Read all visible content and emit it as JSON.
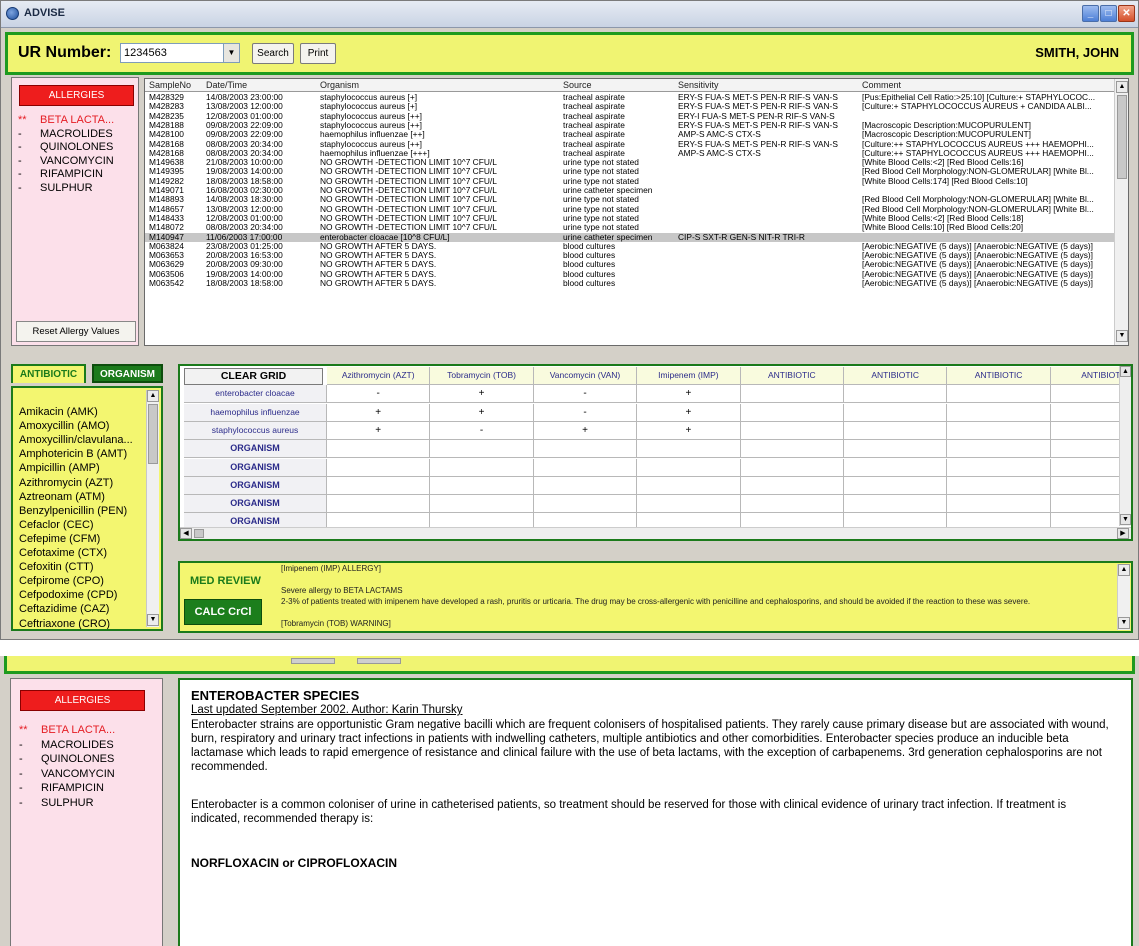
{
  "app": {
    "title": "ADVISE"
  },
  "header": {
    "ur_label": "UR Number:",
    "ur_value": "1234563",
    "search_label": "Search",
    "print_label": "Print",
    "patient_name": "SMITH, JOHN"
  },
  "allergies": {
    "button": "ALLERGIES",
    "reset": "Reset Allergy Values",
    "items": [
      {
        "marker": "**",
        "name": "BETA LACTA...",
        "severe": true
      },
      {
        "marker": "-",
        "name": "MACROLIDES",
        "severe": false
      },
      {
        "marker": "-",
        "name": "QUINOLONES",
        "severe": false
      },
      {
        "marker": "-",
        "name": "VANCOMYCIN",
        "severe": false
      },
      {
        "marker": "-",
        "name": "RIFAMPICIN",
        "severe": false
      },
      {
        "marker": "-",
        "name": "SULPHUR",
        "severe": false
      }
    ]
  },
  "micro": {
    "columns": [
      "SampleNo",
      "Date/Time",
      "Organism",
      "Source",
      "Sensitivity",
      "Comment"
    ],
    "rows": [
      [
        "M428329",
        "14/08/2003 23:00:00",
        "staphylococcus aureus [+]",
        "tracheal aspirate",
        "ERY-S FUA-S MET-S PEN-R RIF-S VAN-S",
        "[Pus:Epithelial Cell Ratio:>25:10] [Culture:+ STAPHYLOCOC..."
      ],
      [
        "M428283",
        "13/08/2003 12:00:00",
        "staphylococcus aureus [+]",
        "tracheal aspirate",
        "ERY-S FUA-S MET-S PEN-R RIF-S VAN-S",
        "[Culture:+ STAPHYLOCOCCUS AUREUS + CANDIDA ALBI..."
      ],
      [
        "M428235",
        "12/08/2003 01:00:00",
        "staphylococcus aureus [++]",
        "tracheal aspirate",
        "ERY-I FUA-S MET-S PEN-R RIF-S VAN-S",
        ""
      ],
      [
        "M428188",
        "09/08/2003 22:09:00",
        "staphylococcus aureus [++]",
        "tracheal aspirate",
        "ERY-S FUA-S MET-S PEN-R RIF-S VAN-S",
        "[Macroscopic Description:MUCOPURULENT]"
      ],
      [
        "M428100",
        "09/08/2003 22:09:00",
        "haemophilus influenzae [++]",
        "tracheal aspirate",
        "AMP-S AMC-S CTX-S",
        "[Macroscopic Description:MUCOPURULENT]"
      ],
      [
        "M428168",
        "08/08/2003 20:34:00",
        "staphylococcus aureus [++]",
        "tracheal aspirate",
        "ERY-S FUA-S MET-S PEN-R RIF-S VAN-S",
        "[Culture:++ STAPHYLOCOCCUS AUREUS +++ HAEMOPHI..."
      ],
      [
        "M428168",
        "08/08/2003 20:34:00",
        "haemophilus influenzae [+++]",
        "tracheal aspirate",
        "AMP-S AMC-S CTX-S",
        "[Culture:++ STAPHYLOCOCCUS AUREUS +++ HAEMOPHI..."
      ],
      [
        "M149638",
        "21/08/2003 10:00:00",
        "NO GROWTH -DETECTION LIMIT 10^7 CFU/L",
        "urine type not stated",
        "",
        "[White Blood Cells:<2] [Red Blood Cells:16]"
      ],
      [
        "M149395",
        "19/08/2003 14:00:00",
        "NO GROWTH -DETECTION LIMIT 10^7 CFU/L",
        "urine type not stated",
        "",
        "[Red Blood Cell Morphology:NON-GLOMERULAR] [White Bl..."
      ],
      [
        "M149282",
        "18/08/2003 18:58:00",
        "NO GROWTH -DETECTION LIMIT 10^7 CFU/L",
        "urine type not stated",
        "",
        "[White Blood Cells:174] [Red Blood Cells:10]"
      ],
      [
        "M149071",
        "16/08/2003 02:30:00",
        "NO GROWTH -DETECTION LIMIT 10^7 CFU/L",
        "urine catheter specimen",
        "",
        ""
      ],
      [
        "M148893",
        "14/08/2003 18:30:00",
        "NO GROWTH -DETECTION LIMIT 10^7 CFU/L",
        "urine type not stated",
        "",
        "[Red Blood Cell Morphology:NON-GLOMERULAR] [White Bl..."
      ],
      [
        "M148657",
        "13/08/2003 12:00:00",
        "NO GROWTH -DETECTION LIMIT 10^7 CFU/L",
        "urine type not stated",
        "",
        "[Red Blood Cell Morphology:NON-GLOMERULAR] [White Bl..."
      ],
      [
        "M148433",
        "12/08/2003 01:00:00",
        "NO GROWTH -DETECTION LIMIT 10^7 CFU/L",
        "urine type not stated",
        "",
        "[White Blood Cells:<2] [Red Blood Cells:18]"
      ],
      [
        "M148072",
        "08/08/2003 20:34:00",
        "NO GROWTH -DETECTION LIMIT 10^7 CFU/L",
        "urine type not stated",
        "",
        "[White Blood Cells:10] [Red Blood Cells:20]"
      ],
      [
        "M140947",
        "11/06/2003 17:00:00",
        "enterobacter cloacae [10^8 CFU/L]",
        "urine catheter specimen",
        "CIP-S SXT-R GEN-S NIT-R TRI-R",
        ""
      ],
      [
        "M063824",
        "23/08/2003 01:25:00",
        "NO GROWTH AFTER 5 DAYS.",
        "blood cultures",
        "",
        "[Aerobic:NEGATIVE (5 days)] [Anaerobic:NEGATIVE (5 days)]"
      ],
      [
        "M063653",
        "20/08/2003 16:53:00",
        "NO GROWTH AFTER 5 DAYS.",
        "blood cultures",
        "",
        "[Aerobic:NEGATIVE (5 days)] [Anaerobic:NEGATIVE (5 days)]"
      ],
      [
        "M063629",
        "20/08/2003 09:30:00",
        "NO GROWTH AFTER 5 DAYS.",
        "blood cultures",
        "",
        "[Aerobic:NEGATIVE (5 days)] [Anaerobic:NEGATIVE (5 days)]"
      ],
      [
        "M063506",
        "19/08/2003 14:00:00",
        "NO GROWTH AFTER 5 DAYS.",
        "blood cultures",
        "",
        "[Aerobic:NEGATIVE (5 days)] [Anaerobic:NEGATIVE (5 days)]"
      ],
      [
        "M063542",
        "18/08/2003 18:58:00",
        "NO GROWTH AFTER 5 DAYS.",
        "blood cultures",
        "",
        "[Aerobic:NEGATIVE (5 days)] [Anaerobic:NEGATIVE (5 days)]"
      ]
    ],
    "selected_index": 15
  },
  "tabs": {
    "antibiotic": "ANTIBIOTIC",
    "organism": "ORGANISM"
  },
  "antibiotics": [
    "Amikacin (AMK)",
    "Amoxycillin (AMO)",
    "Amoxycillin/clavulana...",
    "Amphotericin B (AMT)",
    "Ampicillin (AMP)",
    "Azithromycin (AZT)",
    "Aztreonam (ATM)",
    "Benzylpenicillin (PEN)",
    "Cefaclor (CEC)",
    "Cefepime (CFM)",
    "Cefotaxime (CTX)",
    "Cefoxitin (CTT)",
    "Cefpirome (CPO)",
    "Cefpodoxime (CPD)",
    "Ceftazidime (CAZ)",
    "Ceftriaxone (CRO)"
  ],
  "grid": {
    "clear_label": "CLEAR GRID",
    "columns": [
      "Azithromycin (AZT)",
      "Tobramycin (TOB)",
      "Vancomycin (VAN)",
      "Imipenem (IMP)",
      "ANTIBIOTIC",
      "ANTIBIOTIC",
      "ANTIBIOTIC",
      "ANTIBIOTI"
    ],
    "rows": [
      {
        "organism": "enterobacter cloacae",
        "values": [
          "-",
          "+",
          "-",
          "+",
          "",
          "",
          "",
          ""
        ]
      },
      {
        "organism": "haemophilus influenzae",
        "values": [
          "+",
          "+",
          "-",
          "+",
          "",
          "",
          "",
          ""
        ]
      },
      {
        "organism": "staphylococcus aureus",
        "values": [
          "+",
          "-",
          "+",
          "+",
          "",
          "",
          "",
          ""
        ]
      },
      {
        "organism": "ORGANISM",
        "values": [
          "",
          "",
          "",
          "",
          "",
          "",
          "",
          ""
        ]
      },
      {
        "organism": "ORGANISM",
        "values": [
          "",
          "",
          "",
          "",
          "",
          "",
          "",
          ""
        ]
      },
      {
        "organism": "ORGANISM",
        "values": [
          "",
          "",
          "",
          "",
          "",
          "",
          "",
          ""
        ]
      },
      {
        "organism": "ORGANISM",
        "values": [
          "",
          "",
          "",
          "",
          "",
          "",
          "",
          ""
        ]
      },
      {
        "organism": "ORGANISM",
        "values": [
          "",
          "",
          "",
          "",
          "",
          "",
          "",
          ""
        ]
      }
    ]
  },
  "review": {
    "med_review_label": "MED REVIEW",
    "calc_label": "CALC CrCl",
    "lines": [
      "[Imipenem (IMP) ALLERGY]",
      "",
      "Severe allergy to BETA LACTAMS",
      "2-3% of patients treated with imipenem have developed a rash, pruritis or urticaria. The drug may be cross-allergenic with penicilline and cephalosporins, and should be avoided if the reaction to these was severe.",
      "",
      "[Tobramycin (TOB) WARNING]"
    ]
  },
  "info": {
    "title": "ENTEROBACTER SPECIES",
    "subtitle": "Last updated September 2002. Author: Karin Thursky",
    "para1": "Enterobacter strains are opportunistic Gram negative bacilli which are frequent colonisers of hospitalised patients. They rarely cause primary disease but are associated with wound, burn, respiratory and urinary tract infections in patients with indwelling catheters, multiple antibiotics and other comorbidities. Enterobacter species produce an inducible beta lactamase which leads to rapid emergence of resistance and clinical failure with the use of beta lactams, with the exception of carbapenems. 3rd generation cephalosporins are not recommended.",
    "para2": "Enterobacter is a common coloniser of urine in catheterised patients, so treatment should be reserved for those with clinical evidence of urinary tract infection. If treatment is indicated,  recommended therapy is:",
    "recommendation": "NORFLOXACIN or CIPROFLOXACIN"
  }
}
